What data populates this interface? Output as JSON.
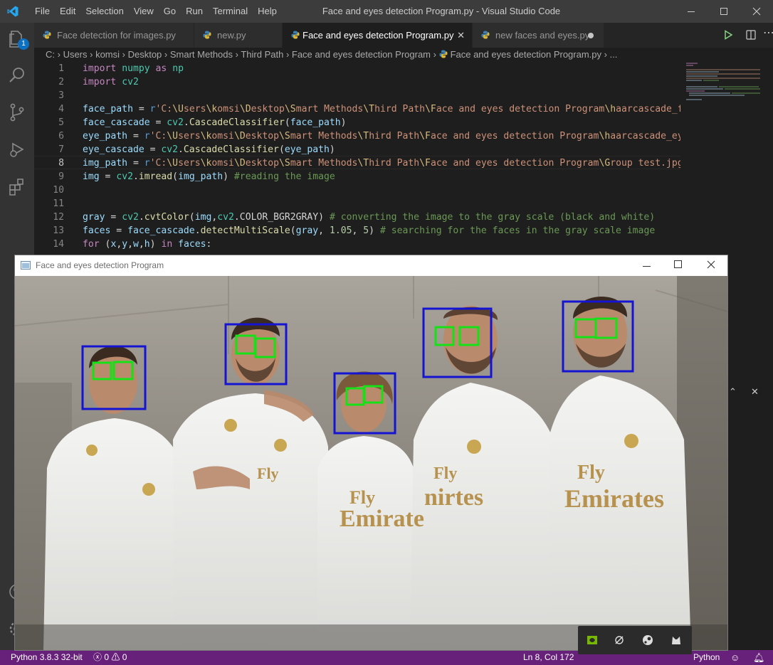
{
  "titlebar": {
    "menu": [
      "File",
      "Edit",
      "Selection",
      "View",
      "Go",
      "Run",
      "Terminal",
      "Help"
    ],
    "title": "Face and eyes detection Program.py - Visual Studio Code"
  },
  "activity_bar": {
    "badge": "1",
    "icons": [
      "explorer-icon",
      "search-icon",
      "source-control-icon",
      "run-debug-icon",
      "extensions-icon",
      "account-icon",
      "settings-gear-icon"
    ]
  },
  "tabs": [
    {
      "label": "Face detection for images.py",
      "active": false,
      "dirty": false
    },
    {
      "label": "new.py",
      "active": false,
      "dirty": false
    },
    {
      "label": "Face and eyes detection Program.py",
      "active": true,
      "dirty": false
    },
    {
      "label": "new faces and eyes.py",
      "active": false,
      "dirty": true
    }
  ],
  "breadcrumb": [
    "C:",
    "Users",
    "komsi",
    "Desktop",
    "Smart Methods",
    "Third Path",
    "Face and eyes detection Program",
    "Face and eyes detection Program.py",
    "..."
  ],
  "code": {
    "current_line": 8,
    "lines": [
      {
        "n": "1",
        "text": "import numpy as np"
      },
      {
        "n": "2",
        "text": "import cv2"
      },
      {
        "n": "3",
        "text": ""
      },
      {
        "n": "4",
        "text": "face_path = r'C:\\Users\\komsi\\Desktop\\Smart Methods\\Third Path\\Face and eyes detection Program\\haarcascade_fro"
      },
      {
        "n": "5",
        "text": "face_cascade = cv2.CascadeClassifier(face_path)"
      },
      {
        "n": "6",
        "text": "eye_path = r'C:\\Users\\komsi\\Desktop\\Smart Methods\\Third Path\\Face and eyes detection Program\\haarcascade_eye."
      },
      {
        "n": "7",
        "text": "eye_cascade = cv2.CascadeClassifier(eye_path)"
      },
      {
        "n": "8",
        "text": "img_path = r'C:\\Users\\komsi\\Desktop\\Smart Methods\\Third Path\\Face and eyes detection Program\\Group test.jpg'"
      },
      {
        "n": "9",
        "text": "img = cv2.imread(img_path) #reading the image"
      },
      {
        "n": "10",
        "text": ""
      },
      {
        "n": "11",
        "text": ""
      },
      {
        "n": "12",
        "text": "gray = cv2.cvtColor(img,cv2.COLOR_BGR2GRAY) # converting the image to the gray scale (black and white)"
      },
      {
        "n": "13",
        "text": "faces = face_cascade.detectMultiScale(gray, 1.05, 5) # searching for the faces in the gray scale image"
      },
      {
        "n": "14",
        "text": "for (x,y,w,h) in faces:"
      }
    ]
  },
  "opencv_window": {
    "title": "Face and eyes detection Program",
    "face_box_color": "#1414d2",
    "eye_box_color": "#16e016"
  },
  "statusbar": {
    "interpreter": "Python 3.8.3 32-bit",
    "errors": "0",
    "warnings": "0",
    "cursor": "Ln 8, Col 172",
    "language": "Python",
    "background": "#68217a"
  }
}
